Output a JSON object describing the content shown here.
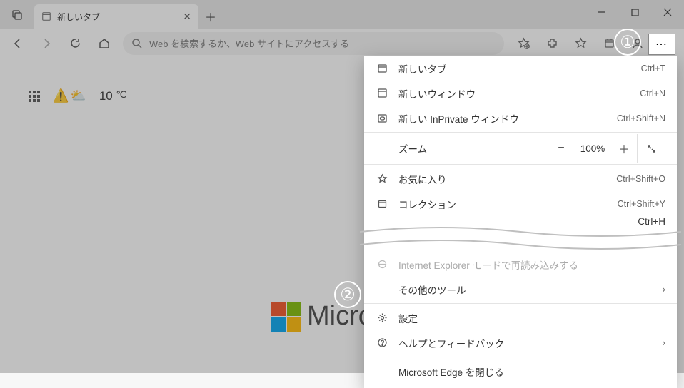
{
  "tab": {
    "title": "新しいタブ"
  },
  "addressbar": {
    "placeholder": "Web を検索するか、Web サイトにアクセスする"
  },
  "weather": {
    "temp": "10",
    "unit": "℃"
  },
  "logo_text": "Micro",
  "menu": {
    "new_tab": "新しいタブ",
    "new_tab_key": "Ctrl+T",
    "new_window": "新しいウィンドウ",
    "new_window_key": "Ctrl+N",
    "new_inprivate": "新しい InPrivate ウィンドウ",
    "new_inprivate_key": "Ctrl+Shift+N",
    "zoom": "ズーム",
    "zoom_val": "100%",
    "favorites": "お気に入り",
    "favorites_key": "Ctrl+Shift+O",
    "collections": "コレクション",
    "collections_key": "Ctrl+Shift+Y",
    "truncated_key": "Ctrl+H",
    "ie_mode": "Internet Explorer モードで再読み込みする",
    "other_tools": "その他のツール",
    "settings": "設定",
    "help": "ヘルプとフィードバック",
    "close_edge": "Microsoft Edge を閉じる"
  },
  "badges": {
    "one": "①",
    "two": "②"
  }
}
